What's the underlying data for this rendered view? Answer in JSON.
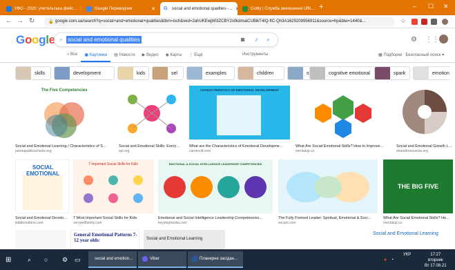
{
  "browser": {
    "tabs": [
      {
        "label": "УФО - 2020: учительська фейс…",
        "active": false,
        "color": "#1877f2"
      },
      {
        "label": "Google Переводчик",
        "active": false,
        "color": "#4285f4"
      },
      {
        "label": "social and emotional qualities -…",
        "active": true,
        "color": "#4285f4"
      },
      {
        "label": "Cuttly | Служба зменшення URL…",
        "active": false,
        "color": "#2b8a3e"
      }
    ],
    "new_tab": "+",
    "url": "google.com.ua/search?q=social+and+emotional+qualities&tbm=isch&ved=2ahUKEwjb03ZCBY2s0kdmaiCUBlkT4IQ-fIC-Qh3A1629209956911&source=hp&biw=1440&…",
    "window_controls": [
      "–",
      "☐",
      "✕"
    ]
  },
  "google": {
    "logo_letters": [
      "G",
      "o",
      "o",
      "g",
      "l",
      "e"
    ],
    "logo_colors": [
      "#4285f4",
      "#ea4335",
      "#fbbc05",
      "#4285f4",
      "#34a853",
      "#ea4335"
    ],
    "query": "social and emotional qualities",
    "tabs": [
      "Все",
      "Картинки",
      "Новости",
      "Видео",
      "Карты",
      "Ещё"
    ],
    "tab_icons": [
      "search-icon",
      "image-icon",
      "news-icon",
      "video-icon",
      "map-icon",
      "more-icon"
    ],
    "tab_glyphs": [
      "⌕",
      "▣",
      "▤",
      "▶",
      "◉",
      "⋮"
    ],
    "active_tab": "Картинки",
    "tools": "Инструменты",
    "collections": "Подборки",
    "safe_search": "Безопасный поиск ▾"
  },
  "chips": [
    {
      "label": "skills",
      "color": "#d9c8b4"
    },
    {
      "label": "development",
      "color": "#7a9cc6"
    },
    {
      "label": "kids",
      "color": "#e8d4a8"
    },
    {
      "label": "sel",
      "color": "#c9a27a"
    },
    {
      "label": "examples",
      "color": "#9bb7d4"
    },
    {
      "label": "children",
      "color": "#d7b89c"
    },
    {
      "label": "students",
      "color": "#8aa9c8"
    },
    {
      "label": "cognitive emotional",
      "color": "#bfbfbf"
    },
    {
      "label": "spark",
      "color": "#7b4a6a"
    },
    {
      "label": "emotion",
      "color": "#e0e0e0"
    }
  ],
  "results_row1": [
    {
      "title": "Social and Emotional Learning / Characteristics of S…",
      "source": "peoriapublicschools.org",
      "image_heading": "The Five Competencies",
      "bg": "#ffffff"
    },
    {
      "title": "Social and Emotional Skills: Every…",
      "source": "epi.org",
      "bg": "#ffffff"
    },
    {
      "title": "What are the Characteristics of Emotional Developme…",
      "source": "careerclif.com",
      "image_heading": "CHARACTERISTICS OF EMOTIONAL DEVELOPMENT",
      "bg": "#29b6e8"
    },
    {
      "title": "What Are Social Emotional Skills? How to Improve…",
      "source": "mentalup.co",
      "bg": "#ffffff"
    },
    {
      "title": "Social and Emotional Growth Less…",
      "source": "sharedresources.org",
      "bg": "#ffffff"
    }
  ],
  "results_row2": [
    {
      "title": "Social and Emotional Develop…",
      "source": "kiddiematters.com",
      "image_heading": "SOCIAL EMOTIONAL",
      "bg": "#ffffff"
    },
    {
      "title": "7 Most Important Social Skills for Kids",
      "source": "verywellfamily.com",
      "image_heading": "7 Important Social Skills for Kids",
      "bg": "#fff3e9"
    },
    {
      "title": "Emotional and Social Intelligence Leadership Competencies…",
      "source": "keystepmedia.com",
      "image_heading": "EMOTIONAL & SOCIAL INTELLIGENCE LEADERSHIP COMPETENCIES",
      "bg": "#e8f7f3"
    },
    {
      "title": "The Fully Formed Leader: Spiritual, Emotional & Soci…",
      "source": "secam.com",
      "bg": "#e4f4fb"
    },
    {
      "title": "What Are Social Emotional Skills? Ho…",
      "source": "mentalup.co",
      "image_heading": "THE BIG FIVE",
      "bg": "#1e7a2e"
    }
  ],
  "results_row3": [
    {
      "image_heading": "",
      "bg": "#f7f7f7"
    },
    {
      "image_heading": "General Emotional Patterns 7-12 year olds:",
      "bg": "#ffffff"
    },
    {
      "image_heading": "Social and Emotional Learning",
      "bg": "#eaeaea"
    },
    {
      "image_heading": "",
      "bg": "#ffffff"
    },
    {
      "image_heading": "Social and Emotional Learning",
      "bg": "#ffffff"
    }
  ],
  "taskbar": {
    "apps": [
      "social and emotion…",
      "Viber",
      "Планерне засідан…"
    ],
    "lang": "УКР",
    "time": "17:27",
    "day": "вторник",
    "date": "Вт 17.08.21"
  }
}
